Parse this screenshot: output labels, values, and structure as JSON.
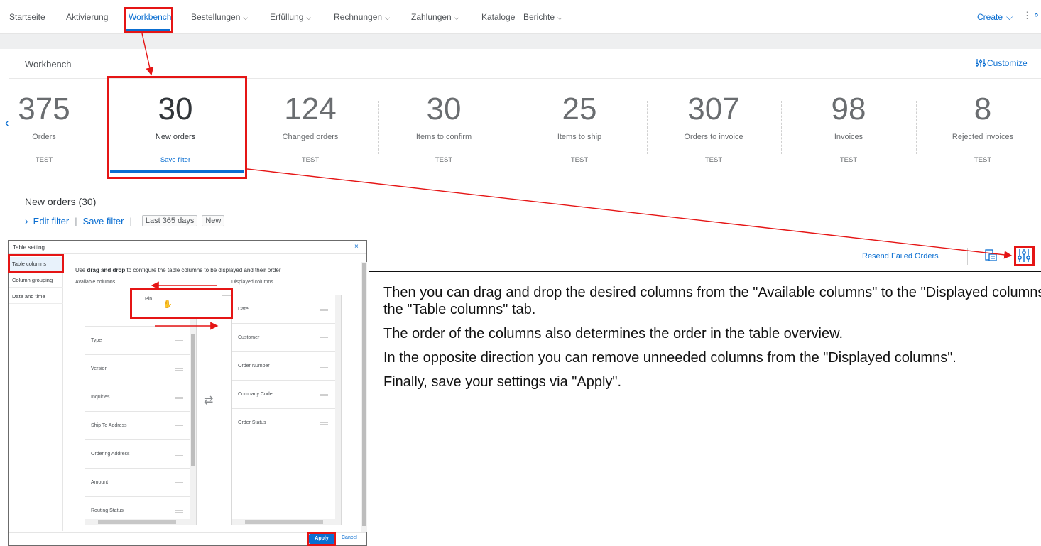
{
  "nav": {
    "items": [
      {
        "label": "Startseite",
        "dropdown": false
      },
      {
        "label": "Aktivierung",
        "dropdown": false
      },
      {
        "label": "Workbench",
        "dropdown": false,
        "active": true
      },
      {
        "label": "Bestellungen",
        "dropdown": true
      },
      {
        "label": "Erfüllung",
        "dropdown": true
      },
      {
        "label": "Rechnungen",
        "dropdown": true
      },
      {
        "label": "Zahlungen",
        "dropdown": true
      },
      {
        "label": "Kataloge",
        "dropdown": false
      },
      {
        "label": "Berichte",
        "dropdown": true
      }
    ],
    "create_label": "Create",
    "chevron": "⌵"
  },
  "workbench": {
    "title": "Workbench",
    "customize_label": "Customize",
    "tiles": [
      {
        "value": "375",
        "label": "Orders",
        "sub": "TEST"
      },
      {
        "value": "30",
        "label": "New orders",
        "sub": "Save filter",
        "active": true
      },
      {
        "value": "124",
        "label": "Changed orders",
        "sub": "TEST"
      },
      {
        "value": "30",
        "label": "Items to confirm",
        "sub": "TEST"
      },
      {
        "value": "25",
        "label": "Items to ship",
        "sub": "TEST"
      },
      {
        "value": "307",
        "label": "Orders to invoice",
        "sub": "TEST"
      },
      {
        "value": "98",
        "label": "Invoices",
        "sub": "TEST"
      },
      {
        "value": "8",
        "label": "Rejected invoices",
        "sub": "TEST"
      }
    ]
  },
  "filter": {
    "section_title": "New orders (30)",
    "edit_filter": "Edit filter",
    "save_filter": "Save filter",
    "chips": [
      "Last 365 days",
      "New"
    ]
  },
  "toolbar": {
    "resend_label": "Resend Failed Orders"
  },
  "dialog": {
    "title": "Table setting",
    "close": "×",
    "tabs": [
      "Table columns",
      "Column grouping",
      "Date and time"
    ],
    "description_pre": "Use ",
    "description_bold": "drag and drop",
    "description_post": " to configure the table columns to be displayed and their order",
    "available_header": "Available columns",
    "displayed_header": "Displayed columns",
    "available_columns": [
      "Type",
      "Version",
      "Inquiries",
      "Ship To Address",
      "Ordering Address",
      "Amount",
      "Routing Status"
    ],
    "displayed_columns": [
      "Date",
      "Customer",
      "Order Number",
      "Company Code",
      "Order Status"
    ],
    "dragging_item": "Pin",
    "apply_label": "Apply",
    "cancel_label": "Cancel"
  },
  "instructions": {
    "p1": "Then you can drag and drop the desired columns from the \"Available columns\" to the \"Displayed columns\" in the \"Table columns\" tab.",
    "p2": "The order of the columns also determines the order in the table overview.",
    "p3": "In the opposite direction you can remove unneeded columns from the \"Displayed columns\".",
    "p4": "Finally, save your settings via \"Apply\"."
  },
  "colors": {
    "accent": "#0a6ed1",
    "annotation": "#e51515"
  }
}
